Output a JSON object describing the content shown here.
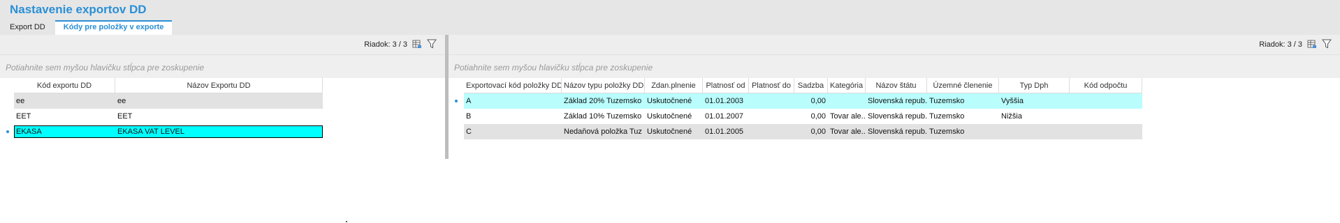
{
  "header": {
    "title": "Nastavenie exportov DD",
    "tabs": [
      {
        "label": "Export DD",
        "active": false
      },
      {
        "label": "Kódy pre položky v exporte",
        "active": true
      }
    ]
  },
  "left_panel": {
    "row_count": "Riadok: 3 / 3",
    "group_hint": "Potiahnite sem myšou hlavičku stĺpca pre zoskupenie",
    "columns": [
      "Kód exportu DD",
      "Názov Exportu DD"
    ],
    "rows": [
      {
        "code": "ee",
        "name": "ee"
      },
      {
        "code": "EET",
        "name": "EET"
      },
      {
        "code": "EKASA",
        "name": "EKASA VAT LEVEL"
      }
    ]
  },
  "right_panel": {
    "row_count": "Riadok: 3 / 3",
    "group_hint": "Potiahnite sem myšou hlavičku stĺpca pre zoskupenie",
    "columns": [
      "Exportovací kód položky DD",
      "Názov typu položky DD",
      "Zdan.plnenie",
      "Platnosť od",
      "Platnosť do",
      "Sadzba",
      "Kategória",
      "Názov štátu",
      "Územné členenie",
      "Typ Dph",
      "Kód odpočtu"
    ],
    "rows": [
      {
        "code": "A",
        "name": "Základ 20% Tuzemsko",
        "zdan": "Uskutočnené",
        "od": "01.01.2003",
        "do": "",
        "sadzba": "0,00",
        "kategoria": "",
        "stat": "Slovenská  repub...",
        "uzemne": "Tuzemsko",
        "typ_dph": "Vyššia",
        "kod_odpoctu": ""
      },
      {
        "code": "B",
        "name": "Základ 10% Tuzemsko",
        "zdan": "Uskutočnené",
        "od": "01.01.2007",
        "do": "",
        "sadzba": "0,00",
        "kategoria": "Tovar ale...",
        "stat": "Slovenská  repub...",
        "uzemne": "Tuzemsko",
        "typ_dph": "Nižšia",
        "kod_odpoctu": ""
      },
      {
        "code": "C",
        "name": "Nedaňová položka Tuz",
        "zdan": "Uskutočnené",
        "od": "01.01.2005",
        "do": "",
        "sadzba": "0,00",
        "kategoria": "Tovar ale...",
        "stat": "Slovenská  repub...",
        "uzemne": "Tuzemsko",
        "typ_dph": "",
        "kod_odpoctu": ""
      }
    ]
  },
  "colors": {
    "accent": "#2a8fd6",
    "selected_row": "#00ffff",
    "current_row": "#b9fdfd",
    "alt_row": "#e2e2e2"
  }
}
